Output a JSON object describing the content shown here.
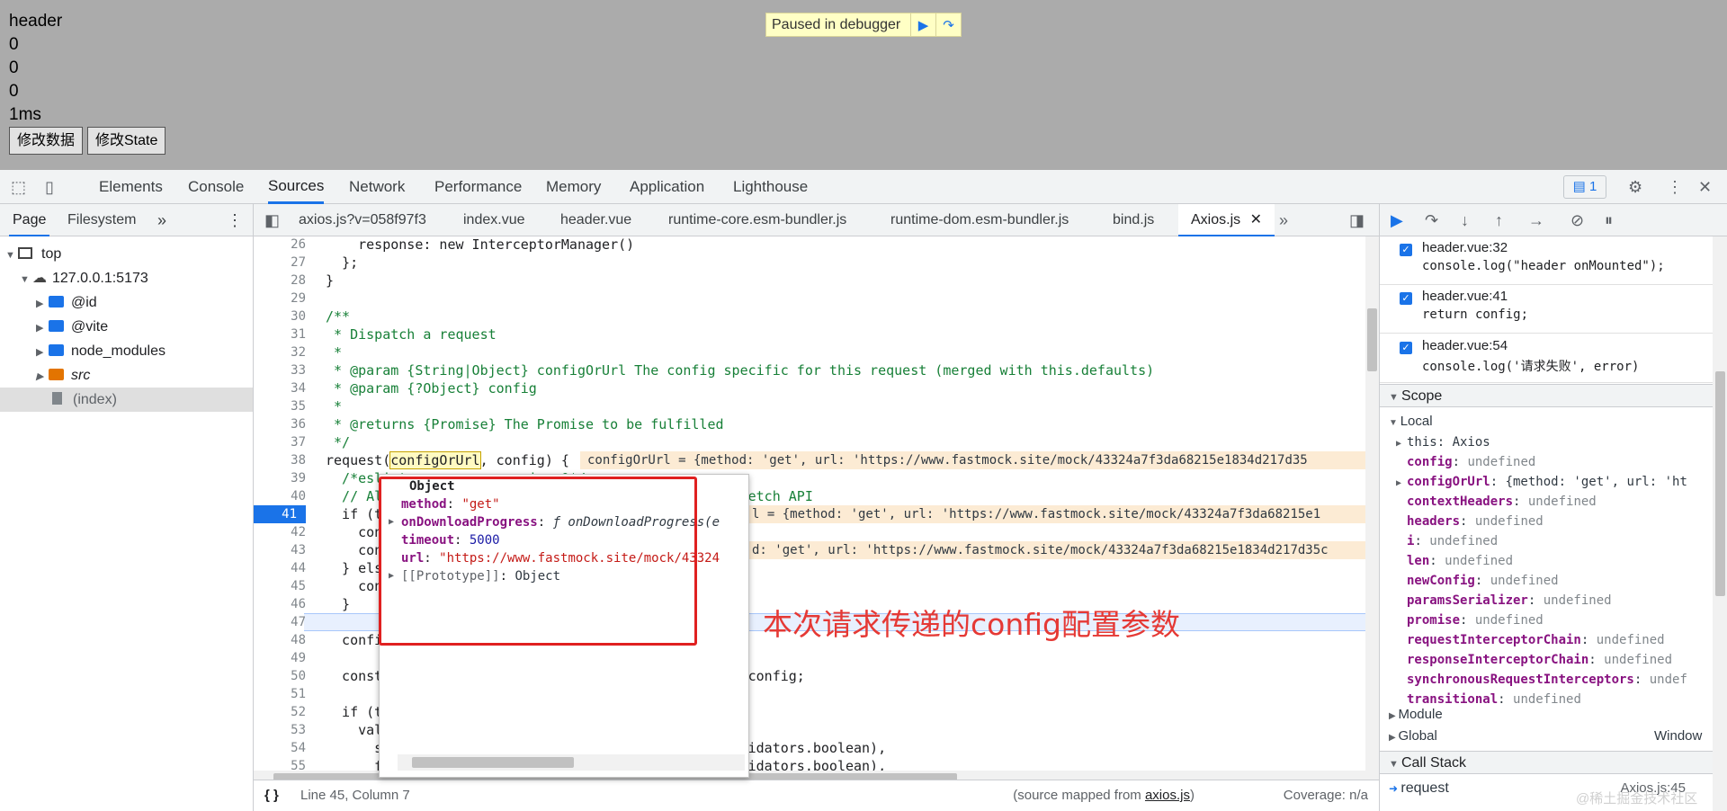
{
  "page": {
    "lines": [
      "header",
      "0",
      "0",
      "0",
      "1ms"
    ],
    "buttons": [
      "修改数据",
      "修改State"
    ],
    "banner": "Paused in debugger"
  },
  "devtools": {
    "tabs": [
      "Elements",
      "Console",
      "Sources",
      "Network",
      "Performance",
      "Memory",
      "Application",
      "Lighthouse"
    ],
    "active_tab": "Sources",
    "message_count": "1",
    "accent": "#1a73e8"
  },
  "navigator": {
    "tabs": [
      "Page",
      "Filesystem"
    ],
    "tree": [
      {
        "label": "top",
        "arrow": "▼",
        "icon": "frame"
      },
      {
        "label": "127.0.0.1:5173",
        "arrow": "▼",
        "icon": "cloud"
      },
      {
        "label": "@id",
        "arrow": "▶",
        "icon": "folder"
      },
      {
        "label": "@vite",
        "arrow": "▶",
        "icon": "folder"
      },
      {
        "label": "node_modules",
        "arrow": "▶",
        "icon": "folder"
      },
      {
        "label": "src",
        "arrow": "▶",
        "icon": "folder-orange"
      },
      {
        "label": "(index)",
        "arrow": "",
        "icon": "file"
      }
    ]
  },
  "editor": {
    "file_tabs": [
      "axios.js?v=058f97f3",
      "index.vue",
      "header.vue",
      "runtime-core.esm-bundler.js",
      "runtime-dom.esm-bundler.js",
      "bind.js",
      "Axios.js"
    ],
    "active_file": "Axios.js",
    "line_numbers": [
      "26",
      "27",
      "28",
      "29",
      "30",
      "31",
      "32",
      "33",
      "34",
      "35",
      "36",
      "37",
      "38",
      "39",
      "40",
      "41",
      "42",
      "43",
      "44",
      "45",
      "46",
      "47",
      "48",
      "49",
      "50",
      "51",
      "52",
      "53",
      "54",
      "55"
    ],
    "breakpoint_line": "41",
    "code": [
      "    response: new InterceptorManager()",
      "  };",
      "}",
      "",
      "/**",
      " * Dispatch a request",
      " *",
      " * @param {String|Object} configOrUrl The config specific for this request (merged with this.defaults)",
      " * @param {?Object} config",
      " *",
      " * @returns {Promise} The Promise to be fulfilled",
      " */",
      "request(configOrUrl, config) {",
      "  /*eslint no-param-reassign:0*/",
      "  // Allow for axios('example/url'[, config]) a la fetch API",
      "  if (typeof configOrUrl === 'string') {",
      "    config = config || {};",
      "    config.url = configOrUrl;",
      "  } else {",
      "    config = configOrUrl || {};",
      "  }",
      "",
      "  config = mergeConfig(this.defaults, config);",
      "",
      "  const {transitional, paramsSerializer, headers} = config;",
      "",
      "  if (transitional !== undefined) {",
      "    validator.assertOptions(transitional, {",
      "      silentJSONParsing: validators.transitional(validators.boolean),",
      "      forcedJSONParsing: validators.transitional(validators.boolean),"
    ],
    "inline_values": [
      "configOrUrl = {method: 'get', url: 'https://www.fastmock.site/mock/43324a7f3da68215e1834d217d35",
      "l = {method: 'get', url: 'https://www.fastmock.site/mock/43324a7f3da68215e1",
      "d: 'get', url: 'https://www.fastmock.site/mock/43324a7f3da68215e1834d217d35c"
    ],
    "popup": {
      "title": "Object",
      "props": [
        {
          "key": "method",
          "value": "\"get\"",
          "expandable": false
        },
        {
          "key": "onDownloadProgress",
          "value": "ƒ onDownloadProgress(e",
          "expandable": true
        },
        {
          "key": "timeout",
          "value": "5000",
          "expandable": false
        },
        {
          "key": "url",
          "value": "\"https://www.fastmock.site/mock/43324",
          "expandable": false
        },
        {
          "key": "[[Prototype]]",
          "value": "Object",
          "expandable": true
        }
      ]
    },
    "annotation": "本次请求传递的config配置参数",
    "status": {
      "position": "Line 45, Column 7",
      "source_mapped_prefix": "(source mapped from ",
      "source_mapped_file": "axios.js",
      "source_mapped_suffix": ")",
      "coverage": "Coverage: n/a"
    }
  },
  "debugger": {
    "breakpoints": [
      {
        "file": "header.vue:32",
        "code": "console.log(\"header onMounted\");"
      },
      {
        "file": "header.vue:41",
        "code": "return config;"
      },
      {
        "file": "header.vue:54",
        "code": "console.log('请求失败', error)"
      }
    ],
    "scope_title": "Scope",
    "local_title": "Local",
    "local_vars": [
      {
        "key": "this",
        "value": "Axios",
        "expand": true,
        "undef": false
      },
      {
        "key": "config",
        "value": "undefined",
        "expand": false,
        "undef": true
      },
      {
        "key": "configOrUrl",
        "value": "{method: 'get', url: 'ht",
        "expand": true,
        "undef": false
      },
      {
        "key": "contextHeaders",
        "value": "undefined",
        "expand": false,
        "undef": true
      },
      {
        "key": "headers",
        "value": "undefined",
        "expand": false,
        "undef": true
      },
      {
        "key": "i",
        "value": "undefined",
        "expand": false,
        "undef": true
      },
      {
        "key": "len",
        "value": "undefined",
        "expand": false,
        "undef": true
      },
      {
        "key": "newConfig",
        "value": "undefined",
        "expand": false,
        "undef": true
      },
      {
        "key": "paramsSerializer",
        "value": "undefined",
        "expand": false,
        "undef": true
      },
      {
        "key": "promise",
        "value": "undefined",
        "expand": false,
        "undef": true
      },
      {
        "key": "requestInterceptorChain",
        "value": "undefined",
        "expand": false,
        "undef": true
      },
      {
        "key": "responseInterceptorChain",
        "value": "undefined",
        "expand": false,
        "undef": true
      },
      {
        "key": "synchronousRequestInterceptors",
        "value": "undef",
        "expand": false,
        "undef": true
      },
      {
        "key": "transitional",
        "value": "undefined",
        "expand": false,
        "undef": true
      }
    ],
    "module_label": "Module",
    "global_label": "Global",
    "global_value": "Window",
    "callstack_title": "Call Stack",
    "callstack": [
      {
        "fn": "request",
        "loc": "Axios.js:45"
      }
    ],
    "watermark": "@稀土掘金技术社区"
  }
}
